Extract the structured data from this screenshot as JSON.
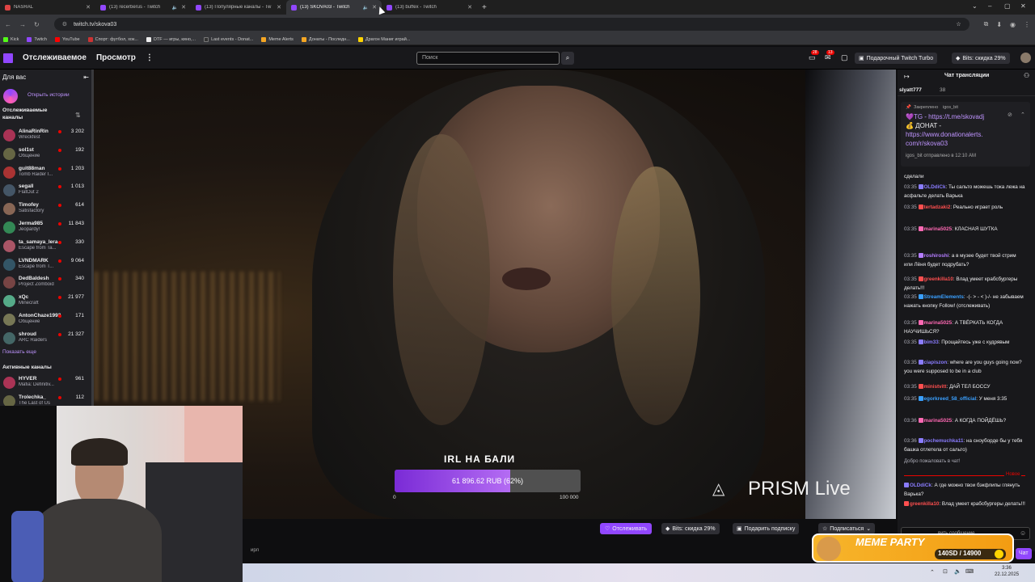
{
  "browser": {
    "tabs": [
      {
        "title": "NASRAL",
        "active": false
      },
      {
        "title": "(13) recerberus - Twitch",
        "active": false
      },
      {
        "title": "(13) Популярные каналы - Tw",
        "active": false
      },
      {
        "title": "(13) SKOVA03 - Twitch",
        "active": true
      },
      {
        "title": "(13) buffex - Twitch",
        "active": false
      }
    ],
    "url": "twitch.tv/skova03",
    "bookmarks": [
      "Kick",
      "Twitch",
      "YouTube",
      "Спорт: футбол, хок...",
      "DTF — игры, кино,...",
      "Last events - Donat...",
      "Meme Alerts",
      "Донаты - Последн...",
      "Драгон Маниг играй..."
    ]
  },
  "nav": {
    "following": "Отслеживаемое",
    "browse": "Просмотр",
    "more": "⋮",
    "search_placeholder": "Поиск",
    "notif_count_1": "28",
    "notif_count_2": "13",
    "turbo": "Подарочный Twitch Turbo",
    "bits": "Bits: скидка 29%"
  },
  "sidebar": {
    "for_you": "Для вас",
    "stories": "Открыть истории",
    "followed_header": "Отслеживаемые каналы",
    "channels": [
      {
        "name": "AlinaRinRin",
        "game": "Wreckfest",
        "viewers": "3 202"
      },
      {
        "name": "sol1st",
        "game": "Общение",
        "viewers": "192"
      },
      {
        "name": "guit88man",
        "game": "Tomb Raider I...",
        "viewers": "1 203"
      },
      {
        "name": "segall",
        "game": "FlatOut 2",
        "viewers": "1 013"
      },
      {
        "name": "Timofey",
        "game": "Satisfactory",
        "viewers": "614"
      },
      {
        "name": "Jerma985",
        "game": "Jeopardy!",
        "viewers": "11 843"
      },
      {
        "name": "ta_samaya_lera",
        "game": "Escape from Ta...",
        "viewers": "330"
      },
      {
        "name": "LVNDMARK",
        "game": "Escape from T...",
        "viewers": "9 064"
      },
      {
        "name": "DedBaldesh",
        "game": "Project Zomboid",
        "viewers": "340"
      },
      {
        "name": "xQc",
        "game": "Minecraft",
        "viewers": "21 977"
      },
      {
        "name": "AntonChaze1993",
        "game": "Общение",
        "viewers": "171"
      },
      {
        "name": "shroud",
        "game": "ARC Raiders",
        "viewers": "21 327"
      }
    ],
    "show_more": "Показать еще",
    "active_header": "Активные каналы",
    "active": [
      {
        "name": "HYVER",
        "game": "Mafia: Definitiv...",
        "viewers": "961"
      },
      {
        "name": "Trolechka_",
        "game": "The Last of Us",
        "viewers": "112"
      }
    ]
  },
  "video": {
    "goal_title": "IRL НА БАЛИ",
    "goal_text": "61 896.62 RUB (62%)",
    "goal_fraction": 0.62,
    "goal_min": "0",
    "goal_max": "100 000",
    "watermark": "PRISM Live",
    "tag": "ирл"
  },
  "below": {
    "follow": "Отслеживать",
    "bits": "Bits: скидка 29%",
    "gift": "Подарить подписку",
    "subscribe": "Подписаться"
  },
  "chat": {
    "title": "Чат трансляции",
    "top_user": "slyatt777",
    "top_count": "38",
    "pinned_label": "Закреплено",
    "pinned_by": "igos_bit",
    "pinned_lines": [
      "💜TG - https://t.me/skovadj",
      "💰 ДОНАТ -",
      "https://www.donationalerts.",
      "com/r/skova03"
    ],
    "pinned_footer": "igos_bit отправлено в 12:10 AM",
    "partial_line": "сделали",
    "messages": [
      {
        "time": "03:35",
        "user": "OLDdiCk",
        "color": "#8a7cff",
        "text": "Ты сальто можешь тока лежа на асфальте делать Варька"
      },
      {
        "time": "03:35",
        "user": "tertadzaki2",
        "color": "#ff4f4f",
        "text": "Реально играет роль"
      },
      {
        "time": "03:35",
        "user": "marina5025",
        "color": "#ff69b4",
        "text": "КЛАСНАЯ ШУТКА"
      },
      {
        "time": "03:35",
        "user": "roshiroshi",
        "color": "#b47cff",
        "text": "а в музее будет твой стрим или Лёня будет подрубать?"
      },
      {
        "time": "03:35",
        "user": "greenkilla10",
        "color": "#ff4f4f",
        "text": "Влад умеет крабсбургеры делать!!!"
      },
      {
        "time": "03:35",
        "user": "StreamElements",
        "color": "#3aa0ff",
        "text": "-(- > - < )-/- не забываем нажать кнопку Follow! (отслеживать)"
      },
      {
        "time": "03:35",
        "user": "marina5025",
        "color": "#ff69b4",
        "text": "А ТВЁРКАТЬ КОГДА НАУЧИШЬСЯ?"
      },
      {
        "time": "03:35",
        "user": "bim33",
        "color": "#8a7cff",
        "text": "Прощайтесь уже с кудрявым"
      },
      {
        "time": "03:35",
        "user": "ciapiszon",
        "color": "#8a7cff",
        "text": "where are you guys going now? you were supposed to be in a club"
      },
      {
        "time": "03:35",
        "user": "ministvitt",
        "color": "#ff4f4f",
        "text": "ДАЙ ТЕЛ БОССУ"
      },
      {
        "time": "03:35",
        "user": "egorkreed_58_official",
        "color": "#3aa0ff",
        "text": "У меня 3:35"
      },
      {
        "time": "03:36",
        "user": "marina5025",
        "color": "#ff69b4",
        "text": "А КОГДА ПОЙДЁШЬ?"
      },
      {
        "time": "03:36",
        "user": "pochemuchka11",
        "color": "#8a7cff",
        "text": "на сноуборде бы у тебя башка отлетела от сальто)"
      }
    ],
    "welcome": "Добро пожаловать в чат!",
    "new_label": "Новое",
    "recent": [
      {
        "user": "OLDdiCk",
        "color": "#8a7cff",
        "text": "А где можно твои бэкфлипы глянуть Варька?"
      },
      {
        "user": "greenkilla10",
        "color": "#ff4f4f",
        "text": "Влад умеет крабсбургеры делать!!!"
      }
    ],
    "input_placeholder": "...вить сообщение",
    "send": "Чат"
  },
  "overlay": {
    "meme_title": "MEME PARTY",
    "meme_progress": "140SD / 14900"
  },
  "taskbar": {
    "time": "3:36",
    "date": "22.12.2025"
  }
}
